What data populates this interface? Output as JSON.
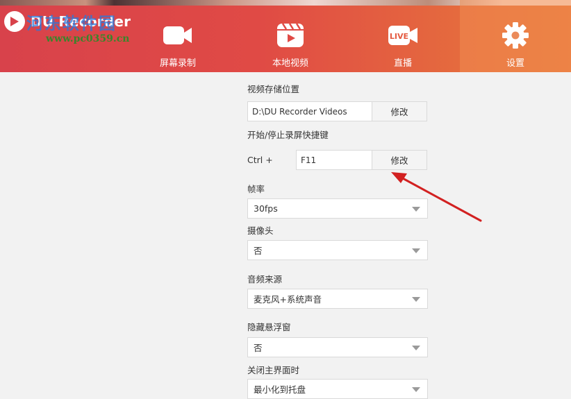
{
  "app": {
    "title": "DU Recorder"
  },
  "watermark": {
    "site_name": "河东软件园",
    "url": "www.pc0359.cn"
  },
  "nav": [
    {
      "label": "屏幕录制",
      "icon": "video-camera-icon",
      "active": false
    },
    {
      "label": "本地视频",
      "icon": "play-video-icon",
      "active": false
    },
    {
      "label": "直播",
      "icon": "live-camera-icon",
      "badge": "LIVE",
      "active": false
    },
    {
      "label": "设置",
      "icon": "gear-icon",
      "active": true
    }
  ],
  "settings": {
    "save_location": {
      "label": "视频存储位置",
      "value": "D:\\DU Recorder Videos",
      "button": "修改"
    },
    "hotkey": {
      "label": "开始/停止录屏快捷键",
      "modifier": "Ctrl +",
      "value": "F11",
      "button": "修改"
    },
    "framerate": {
      "label": "帧率",
      "value": "30fps"
    },
    "camera": {
      "label": "摄像头",
      "value": "否"
    },
    "audio_source": {
      "label": "音频来源",
      "value": "麦克风+系统声音"
    },
    "hide_float": {
      "label": "隐藏悬浮窗",
      "value": "否"
    },
    "close_main": {
      "label": "关闭主界面时",
      "value": "最小化到托盘"
    }
  },
  "colors": {
    "header_red": "#d8424b",
    "header_orange": "#e8783a",
    "annotation_arrow": "#d22121"
  }
}
